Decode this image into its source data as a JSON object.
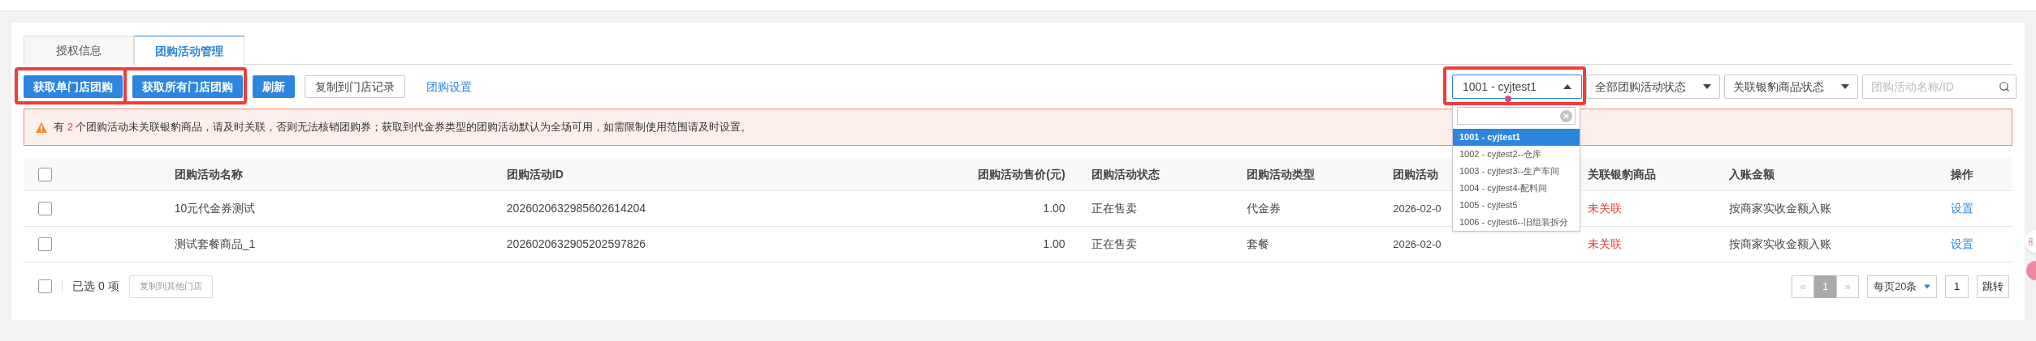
{
  "tabs": [
    {
      "label": "授权信息",
      "selected": false
    },
    {
      "label": "团购活动管理",
      "selected": true
    }
  ],
  "toolbar": {
    "buttons": [
      {
        "label": "获取单门店团购",
        "kind": "primary",
        "highlighted": true
      },
      {
        "label": "获取所有门店团购",
        "kind": "primary",
        "highlighted": true
      },
      {
        "label": "刷新",
        "kind": "primary",
        "highlighted": false
      },
      {
        "label": "复制到门店记录",
        "kind": "default",
        "highlighted": false
      },
      {
        "label": "团购设置",
        "kind": "link",
        "highlighted": false
      }
    ],
    "store_select": {
      "value": "1001 - cyjtest1",
      "expanded": true,
      "highlighted": true,
      "options": [
        {
          "label": "1001 - cyjtest1",
          "selected": true
        },
        {
          "label": "1002 - cyjtest2--仓库",
          "selected": false
        },
        {
          "label": "1003 - cyjtest3--生产车间",
          "selected": false
        },
        {
          "label": "1004 - cyjtest4-配料间",
          "selected": false
        },
        {
          "label": "1005 - cyjtest5",
          "selected": false
        },
        {
          "label": "1006 - cyjtest6--旧组装拆分",
          "selected": false
        }
      ]
    },
    "filters": [
      {
        "value": "全部团购活动状态"
      },
      {
        "value": "关联银豹商品状态"
      }
    ],
    "search": {
      "placeholder": "团购活动名称/ID"
    }
  },
  "alert": {
    "before": "有",
    "count": "2",
    "after": "个团购活动未关联银豹商品，请及时关联，否则无法核销团购券；获取到代金券类型的团购活动默认为全场可用，如需限制使用范围请及时设置。"
  },
  "table": {
    "header_checked": false,
    "columns": [
      "团购活动名称",
      "团购活动ID",
      "团购活动售价(元)",
      "团购活动状态",
      "团购活动类型",
      "团购活动",
      "关联银豹商品",
      "入账金额",
      "操作"
    ],
    "rows": [
      {
        "checked": false,
        "name": "10元代金券测试",
        "id": "2026020632985602614204",
        "price": "1.00",
        "status": "正在售卖",
        "type": "代金券",
        "time": "2026-02-0",
        "link_status": "未关联",
        "linked": false,
        "amount": "按商家实收金额入账",
        "action": "设置"
      },
      {
        "checked": false,
        "name": "测试套餐商品_1",
        "id": "2026020632905202597826",
        "price": "1.00",
        "status": "正在售卖",
        "type": "套餐",
        "time": "2026-02-0",
        "link_status": "未关联",
        "linked": false,
        "amount": "按商家实收金额入账",
        "action": "设置"
      }
    ]
  },
  "footer": {
    "checked": false,
    "selected_text": "已选 0 项",
    "copy_button": {
      "label": "复制到其他门店",
      "disabled": true
    }
  },
  "pagination": {
    "prev": "«",
    "pages": [
      {
        "label": "1",
        "selected": true
      }
    ],
    "next": "»",
    "page_size": "每页20条",
    "page_input": "1",
    "jump": "跳转"
  }
}
